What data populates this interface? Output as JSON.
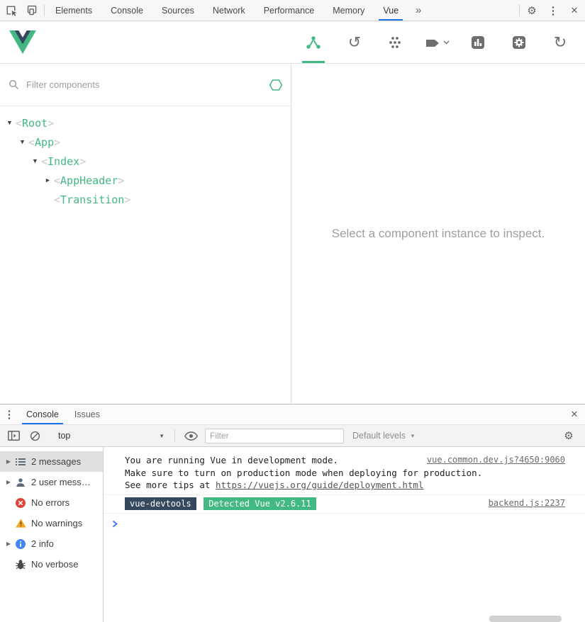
{
  "devtools": {
    "tabs": [
      {
        "label": "Elements"
      },
      {
        "label": "Console"
      },
      {
        "label": "Sources"
      },
      {
        "label": "Network"
      },
      {
        "label": "Performance"
      },
      {
        "label": "Memory"
      },
      {
        "label": "Vue"
      }
    ],
    "active_tab": "Vue"
  },
  "icons": {
    "more_tabs": "»",
    "kebab": "⋮",
    "close": "✕",
    "gear": "⚙",
    "history": "↺",
    "refresh": "↻",
    "caret_down": "▼",
    "tree_expanded": "▼",
    "tree_collapsed": "▶"
  },
  "vue_panel": {
    "filter_placeholder": "Filter components",
    "tree": [
      {
        "label": "Root",
        "state": "expanded"
      },
      {
        "label": "App",
        "state": "expanded"
      },
      {
        "label": "Index",
        "state": "expanded"
      },
      {
        "label": "AppHeader",
        "state": "collapsed"
      },
      {
        "label": "Transition",
        "state": "leaf"
      }
    ],
    "empty_message": "Select a component instance to inspect."
  },
  "console": {
    "tab_console": "Console",
    "tab_issues": "Issues",
    "context": "top",
    "filter_placeholder": "Filter",
    "levels": "Default levels",
    "sidebar": [
      {
        "label": "2 messages",
        "selected": true
      },
      {
        "label": "2 user mess…"
      },
      {
        "label": "No errors"
      },
      {
        "label": "No warnings"
      },
      {
        "label": "2 info"
      },
      {
        "label": "No verbose"
      }
    ],
    "message1": {
      "line1": "You are running Vue in development mode.",
      "line2": "Make sure to turn on production mode when deploying for production.",
      "line3_prefix": "See more tips at ",
      "line3_link": "https://vuejs.org/guide/deployment.html",
      "source": "vue.common.dev.js?4650:9060"
    },
    "message2": {
      "badge1": "vue-devtools",
      "badge2": "Detected Vue v2.6.11",
      "source": "backend.js:2237"
    }
  },
  "colors": {
    "vue_green": "#42b983",
    "vue_dark_slate": "#35495e",
    "active_tab_blue": "#1a73e8"
  }
}
